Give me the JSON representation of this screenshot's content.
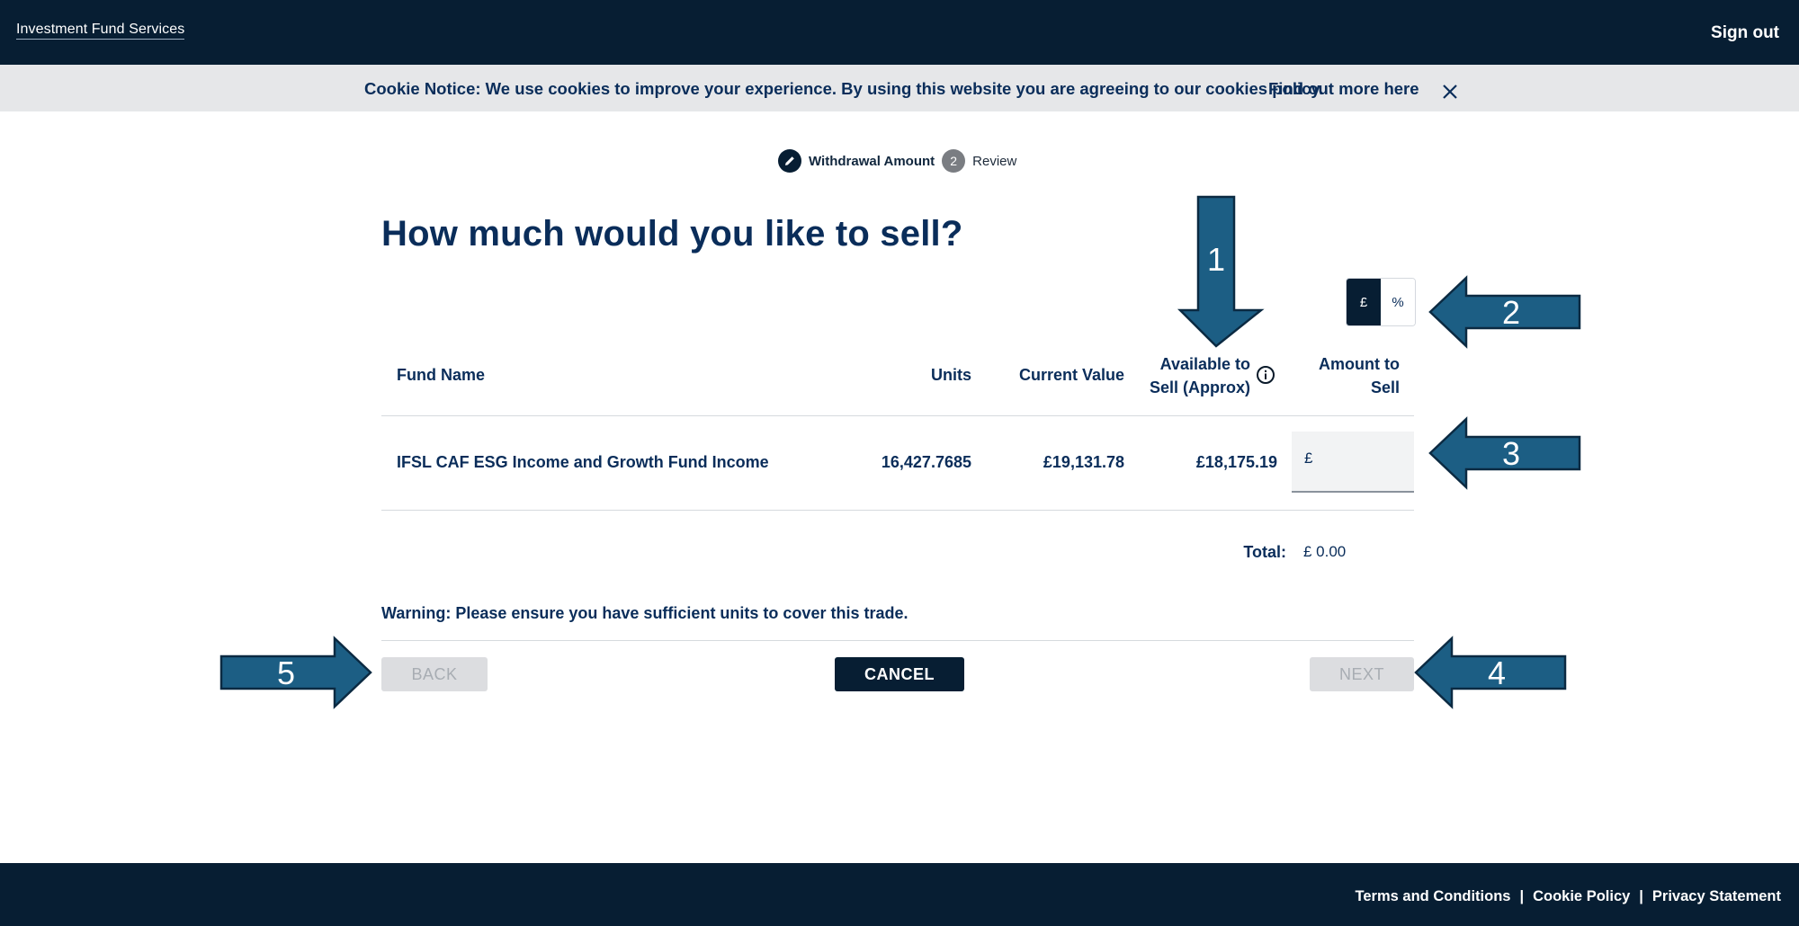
{
  "header": {
    "brand": "Investment Fund Services",
    "signout_label": "Sign out"
  },
  "cookie": {
    "text": "Cookie Notice: We use cookies to improve your experience. By using this website you are agreeing to our cookies policy.",
    "link": "Find out more here",
    "close_icon": "close-icon"
  },
  "stepper": {
    "step1_label": "Withdrawal Amount",
    "step1_icon": "pencil-icon",
    "step2_number": "2",
    "step2_label": "Review"
  },
  "main": {
    "title": "How much would you like to sell?",
    "toggle": {
      "pound": "£",
      "percent": "%",
      "selected": "£"
    },
    "table": {
      "headers": {
        "fund": "Fund Name",
        "units": "Units",
        "current_value": "Current Value",
        "available_line1": "Available to",
        "available_line2": "Sell (Approx)",
        "amount_line1": "Amount to",
        "amount_line2": "Sell"
      },
      "rows": [
        {
          "fund": "IFSL CAF ESG Income and Growth Fund Income",
          "units": "16,427.7685",
          "current_value": "£19,131.78",
          "available": "£18,175.19",
          "amount_prefix": "£",
          "amount_value": ""
        }
      ]
    },
    "total_label": "Total:",
    "total_value": "£ 0.00",
    "warning": "Warning: Please ensure you have sufficient units to cover this trade."
  },
  "buttons": {
    "back": "BACK",
    "cancel": "CANCEL",
    "next": "NEXT"
  },
  "footer": {
    "terms": "Terms and Conditions",
    "cookie_policy": "Cookie Policy",
    "privacy": "Privacy Statement",
    "separator": "|"
  },
  "annotations": {
    "arrow1": "1",
    "arrow2": "2",
    "arrow3": "3",
    "arrow4": "4",
    "arrow5": "5"
  },
  "colors": {
    "navy": "#071e33",
    "text": "#0a2d5a",
    "arrow_fill": "#1c5e84",
    "arrow_stroke": "#0b2a42"
  }
}
